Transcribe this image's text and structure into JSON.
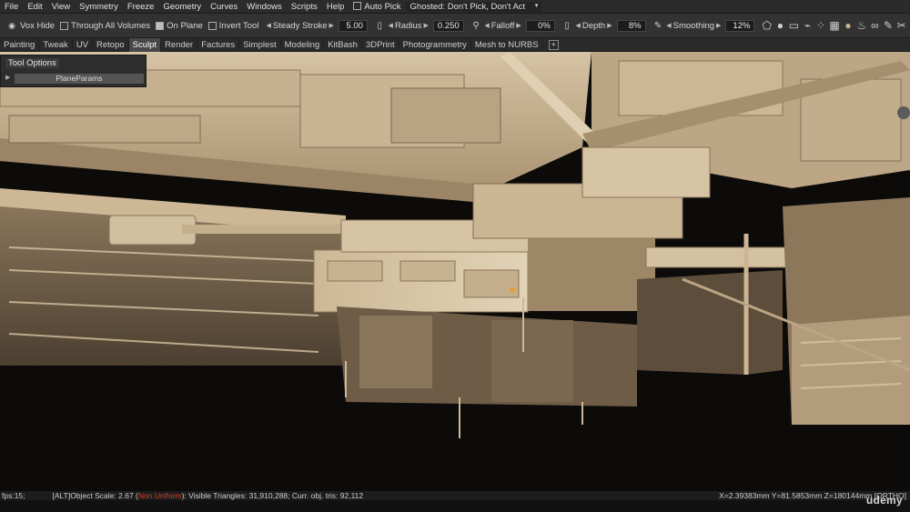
{
  "menu": [
    "File",
    "Edit",
    "View",
    "Symmetry",
    "Freeze",
    "Geometry",
    "Curves",
    "Windows",
    "Scripts",
    "Help"
  ],
  "menu_right": {
    "auto_pick": "Auto  Pick",
    "ghosted": "Ghosted:  Don't  Pick,  Don't  Act"
  },
  "toolbar": {
    "vox_hide": "Vox  Hide",
    "through_all_volumes": "Through  All  Volumes",
    "on_plane": "On  Plane",
    "invert_tool": "Invert  Tool",
    "steady_stroke_label": "Steady  Stroke",
    "steady_stroke_value": "5.00",
    "radius_label": "Radius",
    "radius_value": "0.250",
    "falloff_label": "Falloff",
    "falloff_value": "0%",
    "depth_label": "Depth",
    "depth_value": "8%",
    "smoothing_label": "Smoothing",
    "smoothing_value": "12%"
  },
  "tabs": [
    "Painting",
    "Tweak",
    "UV",
    "Retopo",
    "Sculpt",
    "Render",
    "Factures",
    "Simplest",
    "Modeling",
    "KitBash",
    "3DPrint",
    "Photogrammetry",
    "Mesh  to  NURBS"
  ],
  "active_tab": "Sculpt",
  "add_tab": "+",
  "tool_panel": {
    "title": "Tool  Options",
    "item": "PlaneParams"
  },
  "status": {
    "fps": "fps:15;",
    "scale_prefix": "[ALT]Object  Scale:  2.67  (",
    "non_uniform": "Non  Uniform",
    "scale_suffix": "):  Visible  Triangles:  31,910,288;  Curr. obj. tris:  92,112",
    "coords": "X=2.39383mm  Y=81.5853mm  Z=180144mm  [ORTHO]"
  },
  "watermark": "udemy",
  "colors": {
    "accent_red": "#d23d2b",
    "model": "#c9b393",
    "background": "#0b0a09"
  },
  "icons": [
    "polygon-icon",
    "sphere-icon",
    "rect-select-icon",
    "brush-icon",
    "checker-icon",
    "matcap-icon",
    "paint-bucket-icon",
    "link-icon",
    "pen-icon",
    "scissors-icon"
  ]
}
